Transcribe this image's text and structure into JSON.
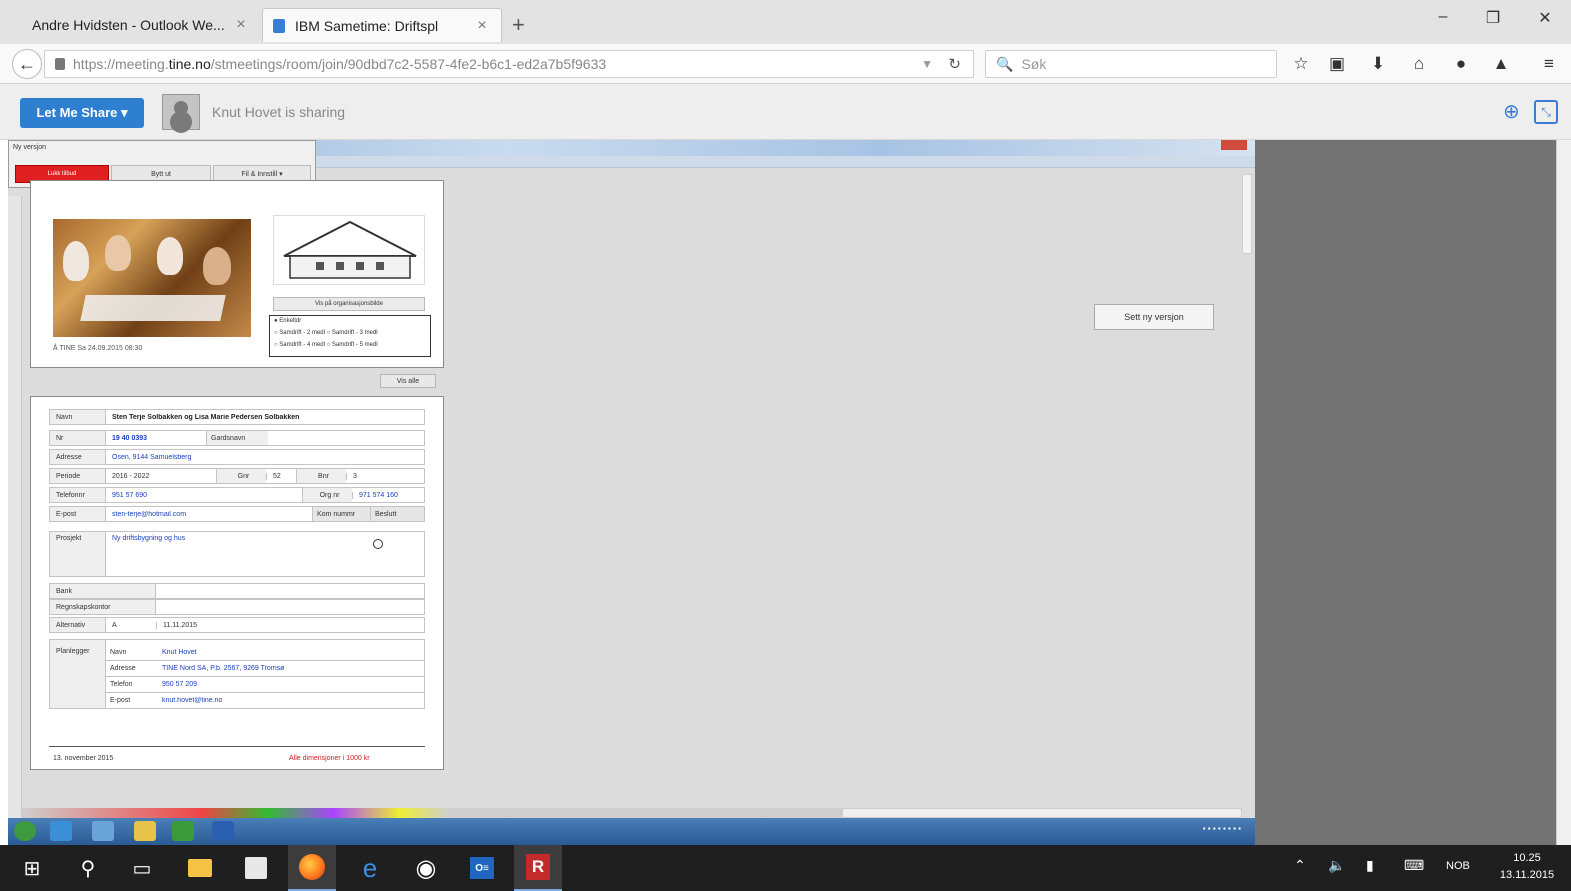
{
  "browser": {
    "tabs": [
      {
        "title": "Andre Hvidsten - Outlook We...",
        "active": false
      },
      {
        "title": "IBM Sametime: Driftspl",
        "active": true
      }
    ],
    "new_tab_glyph": "+",
    "close_glyph": "×",
    "window_controls": {
      "minimize": "–",
      "restore": "❐",
      "close": "✕"
    },
    "url_prefix": "https://meeting.",
    "url_host": "tine.no",
    "url_path": "/stmeetings/room/join/90dbd7c2-5587-4fe2-b6c1-ed2a7b5f9633",
    "search_placeholder": "Søk",
    "nav_icons": [
      "bookmark-star-icon",
      "library-icon",
      "download-icon",
      "home-icon",
      "chat-icon",
      "sametime-icon",
      "menu-icon"
    ]
  },
  "sametime": {
    "share_button": "Let Me Share ▾",
    "sharing_status": "Knut Hovet is sharing"
  },
  "shared_screen": {
    "mini_toolbar": {
      "title": "Ny versjon",
      "red_button": "Lukk tilbud",
      "buttons": [
        "Bytt ut",
        "Fil & Innstill ▾"
      ]
    },
    "photo_caption": "Å TINE Sa     24.09.2015 08:30",
    "house_button": "Vis på organisasjonsbilde",
    "radio_options": [
      "● Enkeltdr",
      "○ Samdrift - 2 medl   ○ Samdrift - 3 medl",
      "○ Samdrift - 4 medl   ○ Samdrift - 5 medl"
    ],
    "show_all_button": "Vis alle",
    "form": {
      "name_label": "Navn",
      "name_value": "Sten Terje Solbakken og Lisa Marie Pedersen Solbakken",
      "nr_label": "Nr",
      "nr_value": "19 40 0393",
      "gardsnavn_label": "Gardsnavn",
      "adresse_label": "Adresse",
      "adresse_value": "Osen, 9144 Samuelsberg",
      "periode_label": "Periode",
      "periode_value": "2016 - 2022",
      "gnr_label": "Gnr",
      "gnr_value": "52",
      "bnr_label": "Bnr",
      "bnr_value": "3",
      "telefon_label": "Telefonnr",
      "telefon_value": "951 57 690",
      "orgnr_label": "Org nr",
      "orgnr_value": "971 574 160",
      "epost_label": "E-post",
      "epost_value": "sten-terje@hotmail.com",
      "form_button_1": "Kom nummr",
      "form_button_2": "Beslutt",
      "prosjekt_label": "Prosjekt",
      "prosjekt_value": "Ny driftsbygning og hus",
      "bank_label": "Bank",
      "regnskap_label": "Regnskapskontor",
      "alternativ_label": "Alternativ",
      "alternativ_value": "A",
      "alternativ_date": "11.11.2015",
      "planlegger_label": "Planlegger",
      "pl_navn_label": "Navn",
      "pl_navn_value": "Knut Hovet",
      "pl_adresse_label": "Adresse",
      "pl_adresse_value": "TINE Nord SA, P.b. 2567, 9269 Tromsø",
      "pl_telefon_label": "Telefon",
      "pl_telefon_value": "950 57 209",
      "pl_epost_label": "E-post",
      "pl_epost_value": "knut.hovet@tine.no",
      "footer_date": "13. november 2015",
      "footer_version": "Alle dimensjoner i 1000 kr"
    },
    "new_version_button": "Sett ny versjon"
  },
  "taskbar": {
    "language": "NOB",
    "time": "10.25",
    "date": "13.11.2015",
    "outlook_label": "O≡",
    "r_label": "R"
  }
}
